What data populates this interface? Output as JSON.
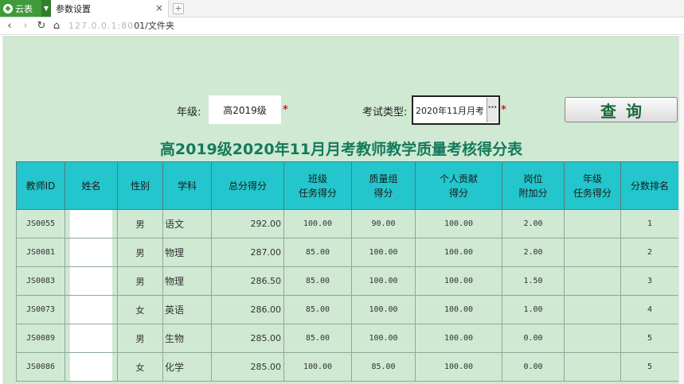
{
  "browser": {
    "app_label": "云表",
    "tab_title": "参数设置",
    "tab_close": "×",
    "new_tab": "+",
    "address_tail": "01/文件夹",
    "address_blurred": "127.0.0.1:80"
  },
  "form": {
    "grade_label": "年级:",
    "grade_value": "高2019级",
    "exam_type_label": "考试类型:",
    "exam_type_value": "2020年11月月考",
    "required_mark": "*",
    "ellipsis": "···",
    "query_button": "查询"
  },
  "report_title": "高2019级2020年11月月考教师教学质量考核得分表",
  "table": {
    "headers": [
      "教师ID",
      "姓名",
      "性别",
      "学科",
      "总分得分",
      "班级\n任务得分",
      "质量组\n得分",
      "个人贡献\n得分",
      "岗位\n附加分",
      "年级\n任务得分",
      "分数排名"
    ],
    "rows": [
      {
        "id": "JS0055",
        "name": "",
        "sex": "男",
        "subject": "语文",
        "total": "292.00",
        "class_task": "100.00",
        "quality_group": "90.00",
        "personal": "100.00",
        "post_bonus": "2.00",
        "grade_task": "",
        "rank": "1"
      },
      {
        "id": "JS0081",
        "name": "",
        "sex": "男",
        "subject": "物理",
        "total": "287.00",
        "class_task": "85.00",
        "quality_group": "100.00",
        "personal": "100.00",
        "post_bonus": "2.00",
        "grade_task": "",
        "rank": "2"
      },
      {
        "id": "JS0083",
        "name": "",
        "sex": "男",
        "subject": "物理",
        "total": "286.50",
        "class_task": "85.00",
        "quality_group": "100.00",
        "personal": "100.00",
        "post_bonus": "1.50",
        "grade_task": "",
        "rank": "3"
      },
      {
        "id": "JS0073",
        "name": "",
        "sex": "女",
        "subject": "英语",
        "total": "286.00",
        "class_task": "85.00",
        "quality_group": "100.00",
        "personal": "100.00",
        "post_bonus": "1.00",
        "grade_task": "",
        "rank": "4"
      },
      {
        "id": "JS0089",
        "name": "",
        "sex": "男",
        "subject": "生物",
        "total": "285.00",
        "class_task": "85.00",
        "quality_group": "100.00",
        "personal": "100.00",
        "post_bonus": "0.00",
        "grade_task": "",
        "rank": "5"
      },
      {
        "id": "JS0086",
        "name": "",
        "sex": "女",
        "subject": "化学",
        "total": "285.00",
        "class_task": "100.00",
        "quality_group": "85.00",
        "personal": "100.00",
        "post_bonus": "0.00",
        "grade_task": "",
        "rank": "5"
      }
    ]
  },
  "icons": {
    "back": "back-arrow-icon",
    "forward": "forward-arrow-icon",
    "refresh": "refresh-icon",
    "home": "home-icon",
    "app_logo": "yunbiao-logo-icon"
  },
  "colors": {
    "page_background": "#cfe9d3",
    "header_background": "#23c6cd",
    "title_color": "#157a5c",
    "app_green": "#3f9a3a",
    "required_red": "#e01818"
  }
}
